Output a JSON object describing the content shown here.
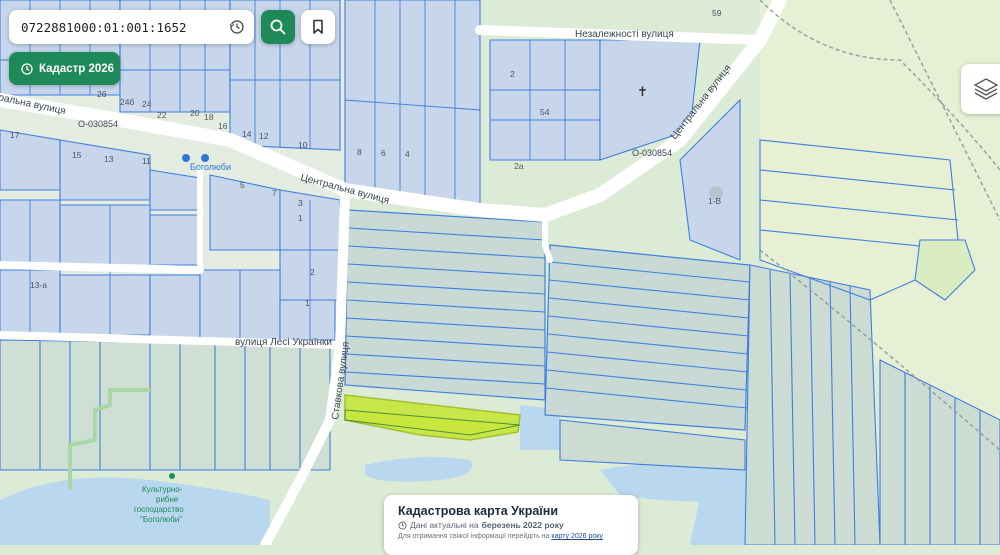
{
  "search": {
    "value": "0722881000:01:001:1652"
  },
  "kadastr_button": {
    "label": "Кадастр 2026"
  },
  "info_card": {
    "title": "Кадастрова карта України",
    "date_prefix": "Дані актуальні на",
    "date_value": "березень 2022 року",
    "note_text": "Для отримання свіжої інформації перейдіть на",
    "note_link": "карту 2026 року"
  },
  "map": {
    "streets": {
      "nezalezhnosti": "Незалежності вулиця",
      "tsentralna_left": "Центральна вулиця",
      "tsentralna_right": "Центральна вулиця",
      "lesi": "вулиця Лесі Українки",
      "stavkova": "Ставкова вулиця",
      "left_street": "ральна вулиця"
    },
    "road_codes": {
      "left": "О-030854",
      "right": "О-030854"
    },
    "places": {
      "bus_stop": "Боголюби",
      "fish_farm": "Культурно-рибне господарство \"Боголюби\""
    },
    "fish_farm_lines": [
      "Культурно-",
      "рибне",
      "господарство",
      "\"Боголюби\""
    ],
    "house_numbers": {
      "n59": "59",
      "n2": "2",
      "n54": "54",
      "n2a": "2а",
      "n26": "26",
      "n24b": "24б",
      "n24": "24",
      "n20": "20",
      "n18": "18",
      "n22": "22",
      "n16": "16",
      "n14": "14",
      "n12": "12",
      "n10": "10",
      "n8": "8",
      "n6": "6",
      "n4": "4",
      "n17": "17",
      "n15": "15",
      "n13": "13",
      "n11": "11",
      "n7": "7",
      "n5": "5",
      "n3": "3",
      "n1": "1",
      "n2b": "2",
      "n1b": "1",
      "n13b": "13",
      "n1v": "1-В",
      "n13a": "13-а"
    },
    "colors": {
      "background": "#dcebd6",
      "parcel_fill": "#c7d6ea",
      "parcel_stroke": "#3f7ee0",
      "highlight": "#c8e63a",
      "water": "#b9d7ee",
      "road": "#ffffff",
      "accent": "#1e8a5a"
    }
  }
}
